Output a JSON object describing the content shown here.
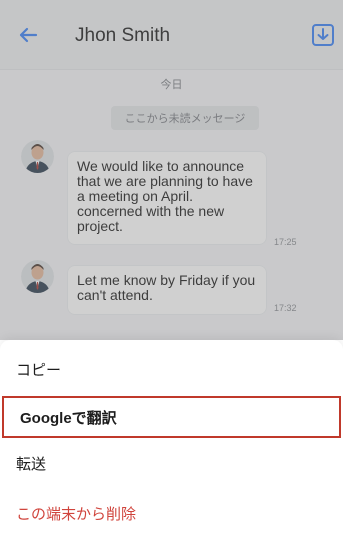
{
  "header": {
    "title": "Jhon Smith"
  },
  "chat": {
    "date": "今日",
    "unread_label": "ここから未読メッセージ",
    "messages": [
      {
        "text": "We would like to announce that we are planning to have a meeting on April. concerned with the new project.",
        "time": "17:25"
      },
      {
        "text": "Let me know by Friday if you can't attend.",
        "time": "17:32"
      }
    ]
  },
  "menu": {
    "items": [
      {
        "label": "コピー"
      },
      {
        "label": "Googleで翻訳"
      },
      {
        "label": "転送"
      },
      {
        "label": "この端末から削除"
      }
    ]
  },
  "colors": {
    "accent": "#3b82f6",
    "danger": "#d0443c",
    "selected_border": "#c0392b"
  }
}
